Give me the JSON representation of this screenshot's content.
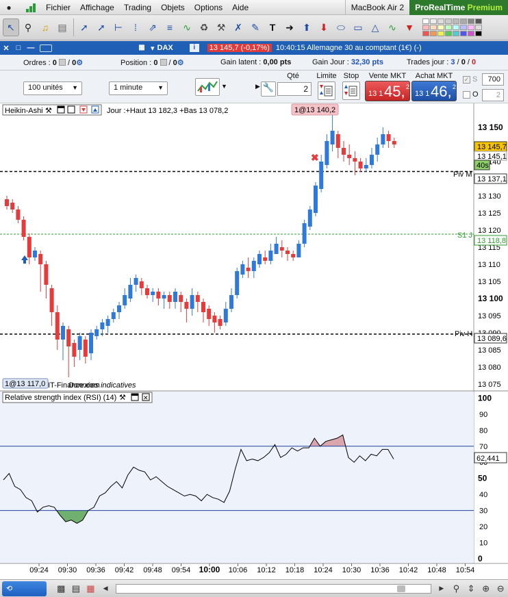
{
  "menubar": {
    "items": [
      "Fichier",
      "Affichage",
      "Trading",
      "Objets",
      "Options",
      "Aide"
    ],
    "device": "MacBook Air 2",
    "brand_a": "ProRealTime",
    "brand_b": "Premium"
  },
  "tab": {
    "instrument": "DAX",
    "price_badge": "13 145,7 (-0,17%)",
    "description": "10:40:15 Allemagne 30 au comptant (1€) (-)"
  },
  "orders": {
    "ordres_label": "Ordres :",
    "ordres_value": "0",
    "ordres_value2": "0",
    "position_label": "Position :",
    "position_value": "0",
    "position_value2": "0",
    "gain_latent_label": "Gain latent :",
    "gain_latent_value": "0,00 pts",
    "gain_jour_label": "Gain Jour :",
    "gain_jour_value": "32,30 pts",
    "trades_label": "Trades jour :",
    "trades_a": "3",
    "trades_b": "0",
    "trades_c": "0"
  },
  "trading": {
    "units": "100 unités",
    "timeframe": "1 minute",
    "qty_label": "Qté",
    "qty_value": "2",
    "limite_label": "Limite",
    "stop_label": "Stop",
    "vente_label": "Vente MKT",
    "achat_label": "Achat MKT",
    "vente_small": "13 1",
    "vente_big": "45,",
    "vente_sup": "2",
    "achat_small": "13 1",
    "achat_big": "46,",
    "achat_sup": "2",
    "s_label": "S",
    "s_value": "700",
    "o_label": "O",
    "o_value": "2"
  },
  "chart_main": {
    "indicator_label": "Heikin-Ashi",
    "day_info": "Jour :+Haut 13 182,3 +Bas 13 078,2",
    "top_badge": "1@13 140,2",
    "bottom_badge": "1@13 117,0",
    "source_text": "IT-Finance.com",
    "data_note": "Données indicatives",
    "piv_m": "Piv M",
    "s1": "S1 J",
    "piv_h": "Piv H",
    "price_tag": "13 145,7",
    "price_tag2": "13 145,1",
    "countdown": "40s",
    "piv_m_tag": "13 137,1",
    "s1_tag": "13 118,8",
    "piv_h_tag": "13 089,6",
    "colors": {
      "up": "#2f7ad8",
      "down": "#e53b3b",
      "piv": "#000000",
      "s1": "#2e9e2e"
    }
  },
  "chart_rsi": {
    "label": "Relative strength index (RSI) (14)",
    "value_tag": "62,441"
  },
  "chart_data": [
    {
      "type": "candlestick",
      "title": "",
      "y_ticks": [
        "13 150",
        "13 145",
        "13 140",
        "13 135",
        "13 130",
        "13 125",
        "13 120",
        "13 115",
        "13 110",
        "13 105",
        "13 100",
        "13 095",
        "13 090",
        "13 085",
        "13 080",
        "13 075"
      ],
      "y_ticks_bold": [
        "13 150",
        "13 100"
      ],
      "ylim": [
        13073,
        13157
      ],
      "x_ticks": [
        "09:24",
        "09:30",
        "09:36",
        "09:42",
        "09:48",
        "09:54",
        "10:00",
        "10:06",
        "10:12",
        "10:18",
        "10:24",
        "10:30",
        "10:36",
        "10:42",
        "10:48",
        "10:54"
      ],
      "levels": {
        "piv_m": 13137.1,
        "s1_j": 13118.8,
        "piv_h": 13089.6,
        "last": 13145.7
      },
      "candles": [
        [
          13129,
          13127,
          13130,
          13126
        ],
        [
          13128,
          13126,
          13129,
          13125
        ],
        [
          13126,
          13123,
          13127,
          13122
        ],
        [
          13123,
          13118,
          13124,
          13117
        ],
        [
          13118,
          13112,
          13119,
          13110
        ],
        [
          13112,
          13114,
          13115,
          13111
        ],
        [
          13113,
          13110,
          13114,
          13102
        ],
        [
          13110,
          13104,
          13111,
          13100
        ],
        [
          13103,
          13096,
          13104,
          13092
        ],
        [
          13096,
          13088,
          13098,
          13085
        ],
        [
          13088,
          13092,
          13093,
          13082
        ],
        [
          13091,
          13086,
          13092,
          13077
        ],
        [
          13087,
          13083,
          13088,
          13080
        ],
        [
          13085,
          13089,
          13090,
          13082
        ],
        [
          13088,
          13083,
          13089,
          13081
        ],
        [
          13084,
          13090,
          13091,
          13082
        ],
        [
          13089,
          13091,
          13092,
          13088
        ],
        [
          13091,
          13093,
          13094,
          13089
        ],
        [
          13092,
          13094,
          13095,
          13090
        ],
        [
          13094,
          13096,
          13097,
          13093
        ],
        [
          13096,
          13098,
          13099,
          13094
        ],
        [
          13098,
          13101,
          13103,
          13097
        ],
        [
          13100,
          13104,
          13106,
          13099
        ],
        [
          13104,
          13106,
          13107,
          13102
        ],
        [
          13105,
          13103,
          13106,
          13101
        ],
        [
          13103,
          13101,
          13104,
          13100
        ],
        [
          13101,
          13102,
          13103,
          13099
        ],
        [
          13102,
          13100,
          13103,
          13098
        ],
        [
          13100,
          13101,
          13102,
          13097
        ],
        [
          13101,
          13099,
          13102,
          13097
        ],
        [
          13099,
          13102,
          13103,
          13097
        ],
        [
          13101,
          13099,
          13102,
          13096
        ],
        [
          13099,
          13097,
          13100,
          13093
        ],
        [
          13097,
          13101,
          13103,
          13095
        ],
        [
          13101,
          13099,
          13102,
          13096
        ],
        [
          13099,
          13096,
          13100,
          13093
        ],
        [
          13097,
          13094,
          13098,
          13092
        ],
        [
          13095,
          13093,
          13096,
          13090
        ],
        [
          13094,
          13092,
          13095,
          13091
        ],
        [
          13093,
          13097,
          13099,
          13092
        ],
        [
          13097,
          13101,
          13103,
          13096
        ],
        [
          13101,
          13108,
          13109,
          13100
        ],
        [
          13107,
          13110,
          13111,
          13106
        ],
        [
          13109,
          13108,
          13112,
          13106
        ],
        [
          13108,
          13111,
          13112,
          13106
        ],
        [
          13110,
          13113,
          13114,
          13109
        ],
        [
          13112,
          13111,
          13114,
          13110
        ],
        [
          13111,
          13114,
          13116,
          13110
        ],
        [
          13113,
          13116,
          13118,
          13113
        ],
        [
          13115,
          13114,
          13117,
          13112
        ],
        [
          13114,
          13113,
          13115,
          13111
        ],
        [
          13113,
          13112,
          13114,
          13111
        ],
        [
          13112,
          13116,
          13117,
          13112
        ],
        [
          13116,
          13122,
          13123,
          13115
        ],
        [
          13121,
          13126,
          13127,
          13120
        ],
        [
          13125,
          13133,
          13134,
          13124
        ],
        [
          13132,
          13140,
          13142,
          13131
        ],
        [
          13139,
          13146,
          13148,
          13138
        ],
        [
          13145,
          13149,
          13155,
          13143
        ],
        [
          13148,
          13144,
          13149,
          13141
        ],
        [
          13144,
          13142,
          13146,
          13140
        ],
        [
          13142,
          13141,
          13145,
          13139
        ],
        [
          13141,
          13140,
          13143,
          13136
        ],
        [
          13140,
          13138,
          13141,
          13137
        ],
        [
          13138,
          13139,
          13141,
          13137
        ],
        [
          13139,
          13142,
          13144,
          13138
        ],
        [
          13142,
          13145,
          13147,
          13140
        ],
        [
          13145,
          13148,
          13150,
          13144
        ],
        [
          13148,
          13146,
          13149,
          13144
        ],
        [
          13146,
          13145,
          13147,
          13144
        ]
      ]
    },
    {
      "type": "line",
      "title": "Relative strength index (RSI) (14)",
      "y_ticks": [
        "100",
        "90",
        "80",
        "70",
        "60",
        "50",
        "40",
        "30",
        "20",
        "10",
        "0"
      ],
      "ylim": [
        -3,
        104
      ],
      "levels": [
        70,
        30
      ],
      "last_value": 62.441,
      "values": [
        49,
        53,
        45,
        43,
        38,
        36,
        29,
        32,
        33,
        32,
        27,
        23,
        24,
        22,
        24,
        30,
        32,
        39,
        41,
        45,
        48,
        44,
        52,
        57,
        55,
        54,
        49,
        51,
        48,
        45,
        43,
        41,
        39,
        40,
        39,
        36,
        40,
        38,
        37,
        35,
        42,
        56,
        68,
        61,
        62,
        61,
        63,
        66,
        71,
        63,
        65,
        69,
        67,
        69,
        69,
        75,
        70,
        73,
        74,
        75,
        77,
        63,
        60,
        64,
        61,
        65,
        64,
        68,
        68,
        62
      ]
    }
  ]
}
